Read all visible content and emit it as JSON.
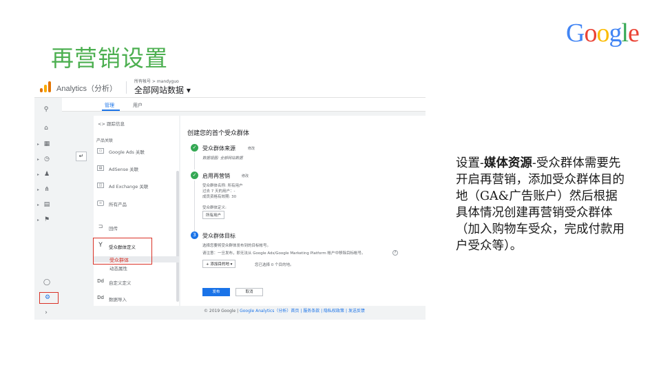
{
  "slide": {
    "title": "再营销设置",
    "logo_letters": [
      "G",
      "o",
      "o",
      "g",
      "l",
      "e"
    ],
    "logo_colors": [
      "#4285f4",
      "#ea4335",
      "#fbbc05",
      "#4285f4",
      "#34a853",
      "#ea4335"
    ],
    "desc_prefix": "设置-",
    "desc_bold": "媒体资源",
    "desc_rest": "-受众群体需要先开启再营销，添加受众群体目的地（GA&广告账户）然后根据具体情况创建再营销受众群体（加入购物车受众，完成付款用户受众等）。"
  },
  "ga": {
    "app_name": "Analytics（分析）",
    "account_small": "所有帐号 > mandyguo",
    "property": "全部网站数据 ▾",
    "tabs": [
      "管理",
      "用户"
    ],
    "rail_icons": [
      "search-icon",
      "home-icon",
      "dashboard-icon",
      "clock-icon",
      "person-icon",
      "share-icon",
      "report-icon",
      "flag-icon",
      "bulb-icon",
      "gear-icon",
      "expand-icon"
    ],
    "menu": {
      "tracking": "<> 跟踪信息",
      "product_link_label": "产品关联",
      "items": [
        "Google Ads 关联",
        "AdSense 关联",
        "Ad Exchange 关联",
        "所有产品",
        "回传"
      ],
      "audience_def": "受众群体定义",
      "audience": "受众群体",
      "dynamic_attr": "动态属性",
      "custom_def": "自定义定义",
      "data_import": "数据导入"
    },
    "wizard": {
      "title": "创建您的首个受众群体",
      "step1_title": "受众群体来源",
      "step1_edit": "修改",
      "step1_text": "数据视图: 全部网站数据",
      "step2_title": "启用再营销",
      "step2_edit": "修改",
      "step2_lines": [
        "受众群体名称: 所有用户",
        "过去 7 天的用户：-",
        "成员资格有效期: 30"
      ],
      "step2_def_label": "受众群体定义:",
      "step2_chip": "所有用户",
      "step3_num": "3",
      "step3_title": "受众群体目标",
      "step3_line1": "选择您要将受众群体发布到的目标帐号。",
      "step3_line2": "请注意：一旦发布，即无法从 Google Ads/Google Marketing Platform 帐户中移除目标帐号。",
      "add_dest": "+ 添加目的地 ▾",
      "selected": "您已选择 0 个目的地。",
      "publish": "发布",
      "cancel": "取消"
    },
    "footer_plain": "© 2019 Google | ",
    "footer_links": "Google Analytics（分析）首页 | 服务条款 | 隐私权政策 | 发送反馈"
  }
}
